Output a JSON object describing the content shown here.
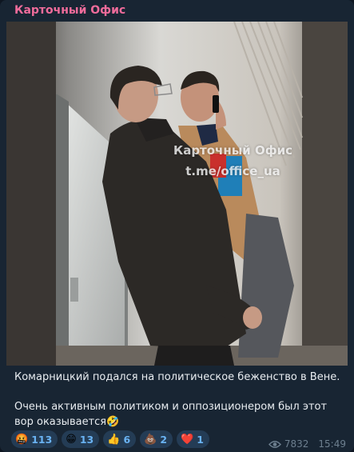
{
  "channel": {
    "name": "Карточный Офис"
  },
  "media": {
    "watermark_line1": "Карточный Офис",
    "watermark_line2": "t.me/office_ua"
  },
  "message": {
    "line1": "Комарницкий подался на политическое беженство в Вене.",
    "line2": "Очень активным политиком и оппозиционером был этот вор оказывается🤣"
  },
  "reactions": [
    {
      "emoji": "🤬",
      "count": "113"
    },
    {
      "emoji": "😁",
      "count": "13"
    },
    {
      "emoji": "👍",
      "count": "6"
    },
    {
      "emoji": "💩",
      "count": "2"
    },
    {
      "emoji": "❤️",
      "count": "1"
    }
  ],
  "meta": {
    "views": "7832",
    "time": "15:49",
    "icon": "eye-icon"
  },
  "colors": {
    "bubble": "#182533",
    "channel_name": "#f06c9b",
    "reaction_bg": "#243c55",
    "reaction_count": "#6ab3f3",
    "meta": "#6d7f8f"
  }
}
